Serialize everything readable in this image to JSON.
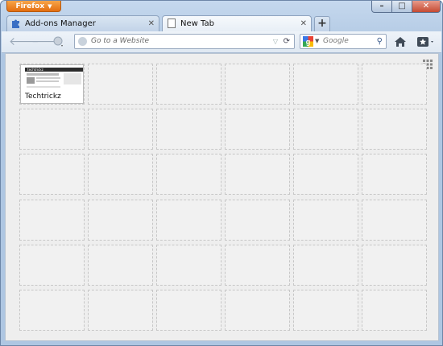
{
  "app": {
    "menu_button": "Firefox"
  },
  "tabs": [
    {
      "label": "Add-ons Manager",
      "icon": "puzzle-icon",
      "active": false
    },
    {
      "label": "New Tab",
      "icon": "blank-page-icon",
      "active": true
    }
  ],
  "navbar": {
    "url_placeholder": "Go to a Website",
    "search_placeholder": "Google"
  },
  "new_tab_page": {
    "rows": 6,
    "cols": 6,
    "tiles": [
      {
        "title": "Techtrickz",
        "thumbnail_heading": "techtrickz"
      }
    ]
  },
  "colors": {
    "firefox_button": "#e46e10",
    "frame": "#b7cde6",
    "content_bg": "#eeeeee"
  }
}
